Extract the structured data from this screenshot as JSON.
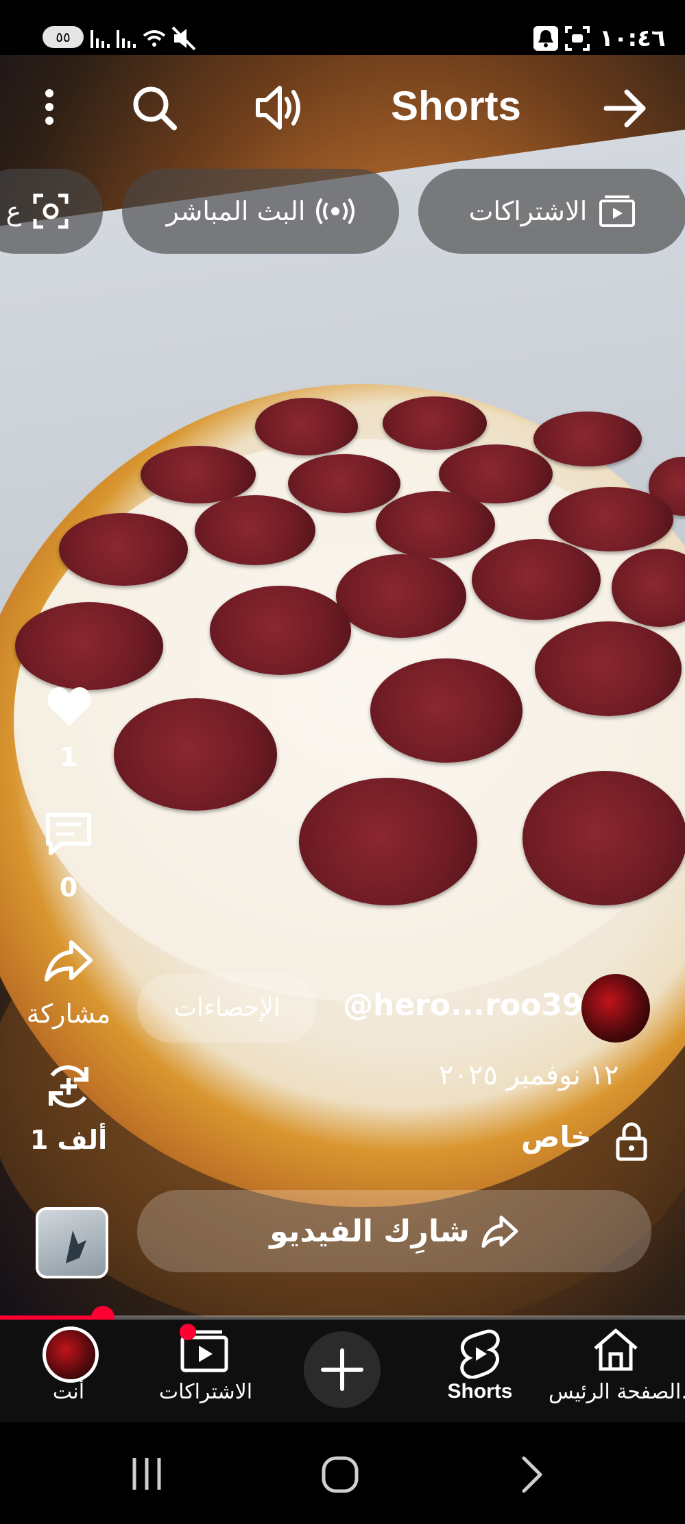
{
  "status_bar": {
    "time": "١٠:٤٦",
    "battery": "٥٥"
  },
  "top_bar": {
    "title": "Shorts"
  },
  "chips": {
    "subscriptions": "الاشتراكات",
    "live": "البث المباشر",
    "partial": "ع"
  },
  "actions": {
    "likes": "1",
    "comments": "0",
    "share_label": "مشاركة",
    "remix_count": "1 ألف"
  },
  "video_info": {
    "stats_button": "الإحصاءات",
    "channel_handle": "@hero...roo39",
    "date": "١٢ نوفمبر ٢٠٢٥",
    "privacy": "خاص",
    "share_video_button": "شارِك الفيديو"
  },
  "progress": {
    "fraction": 0.15
  },
  "bottom_nav": {
    "items": [
      {
        "label": "الصفحة الرئيس..."
      },
      {
        "label": "Shorts"
      },
      {
        "label": ""
      },
      {
        "label": "الاشتراكات"
      },
      {
        "label": "أنت"
      }
    ]
  },
  "colors": {
    "accent": "#ff0033"
  }
}
